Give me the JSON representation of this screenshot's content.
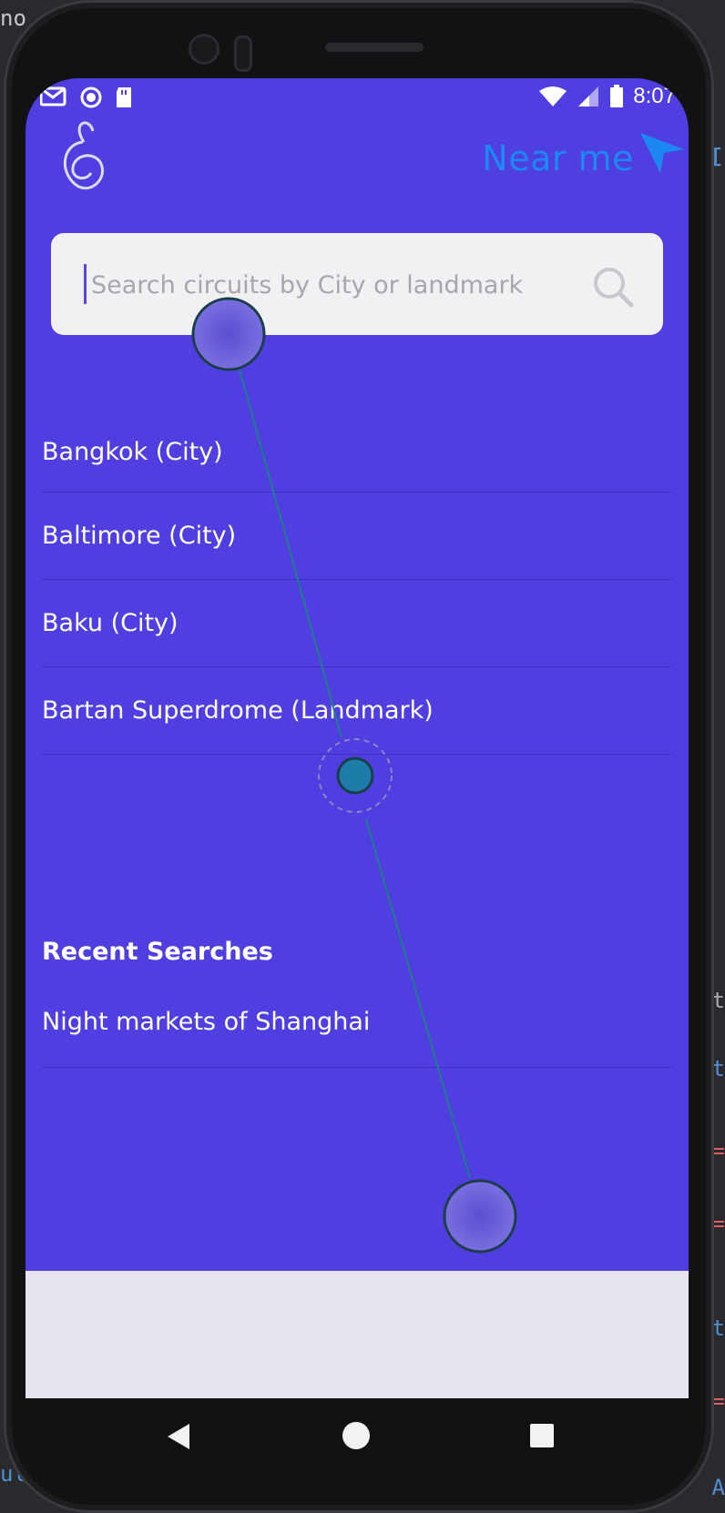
{
  "background": {
    "edge_top_left": "no",
    "edge_right_1": "I",
    "edge_right_2": "t",
    "edge_right_3": "t",
    "edge_right_4": "=",
    "edge_right_5": "=",
    "edge_right_6": "t",
    "edge_right_7": "=",
    "edge_bottom_left": "ul",
    "edge_bottom_right": "A"
  },
  "status_bar": {
    "time": "8:07",
    "icons": [
      "gmail-icon",
      "radio-icon",
      "sd-card-icon",
      "wifi-icon",
      "signal-icon",
      "battery-icon"
    ]
  },
  "header": {
    "logo_icon": "swirl-logo-icon",
    "near_me_label": "Near me",
    "near_me_icon": "navigation-arrow-icon",
    "near_me_color": "#1e88f2"
  },
  "search": {
    "placeholder": "Search circuits by City or landmark",
    "value": "",
    "icon": "search-icon"
  },
  "results": [
    {
      "label": "Bangkok (City)"
    },
    {
      "label": "Baltimore (City)"
    },
    {
      "label": "Baku (City)"
    },
    {
      "label": "Bartan Superdrome (Landmark)"
    }
  ],
  "recent": {
    "title": "Recent Searches",
    "items": [
      {
        "label": "Night markets of Shanghai"
      }
    ]
  },
  "navbar": {
    "icons": [
      "back-icon",
      "home-icon",
      "recents-icon"
    ]
  },
  "colors": {
    "screen_bg": "#4f3ee0",
    "bottom_area_bg": "#e8e4ed",
    "touch_trail": "#1e7d8c"
  }
}
